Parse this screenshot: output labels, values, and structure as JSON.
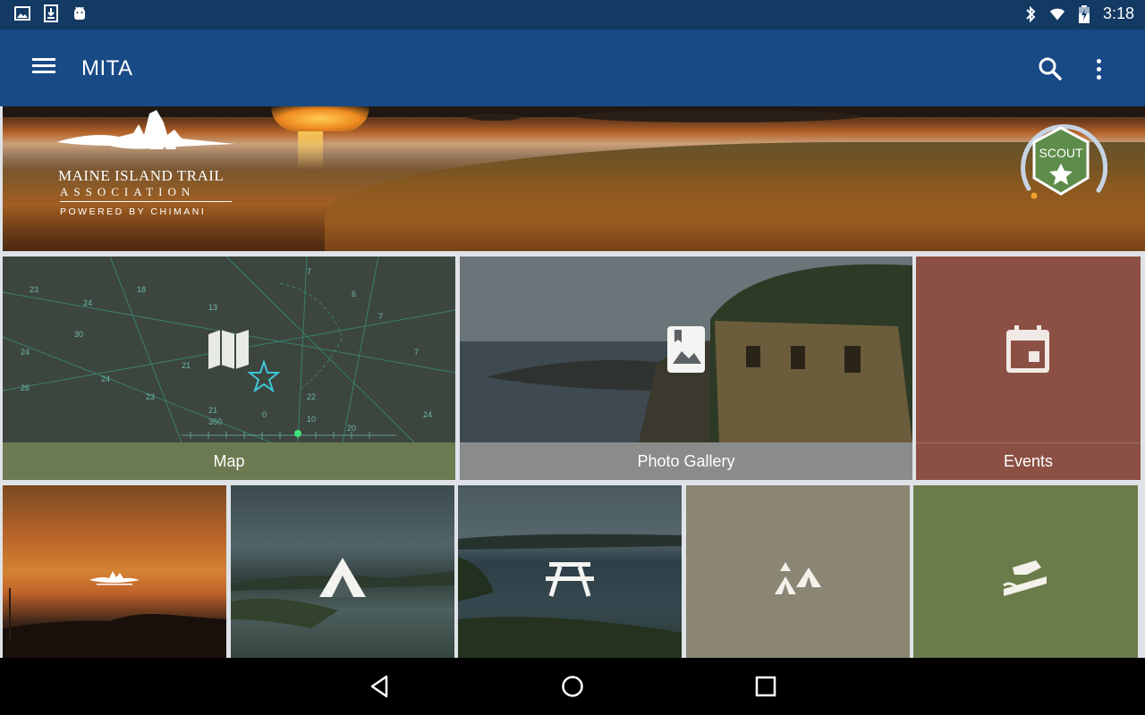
{
  "status_bar": {
    "time": "3:18",
    "left_icons": [
      "gallery-icon",
      "download-icon",
      "android-debug-icon"
    ],
    "right_icons": [
      "bluetooth-icon",
      "wifi-icon",
      "battery-icon"
    ]
  },
  "app_bar": {
    "title": "MITA",
    "menu_icon": "hamburger-menu-icon",
    "search_icon": "search-icon",
    "overflow_icon": "more-vert-icon",
    "background": "#184a86"
  },
  "hero": {
    "logo_name": "MAINE ISLAND TRAIL",
    "logo_sub": "ASSOCIATION",
    "logo_powered": "POWERED BY CHIMANI",
    "badge_label": "SCOUT",
    "badge_color": "#5e8c4a"
  },
  "tiles": {
    "map": {
      "label": "Map",
      "icon": "map-icon",
      "label_bg": "#6b7a50"
    },
    "photo_gallery": {
      "label": "Photo Gallery",
      "icon": "photo-gallery-icon",
      "label_bg": "#8a8b8b"
    },
    "events": {
      "label": "Events",
      "icon": "calendar-icon",
      "label_bg": "#8b5043"
    },
    "bottom_row_icons": [
      "mita-logo-icon",
      "tent-icon",
      "picnic-table-icon",
      "group-campsite-icon",
      "boat-launch-icon"
    ]
  },
  "nav_bar": {
    "icons": [
      "back-icon",
      "home-icon",
      "recents-icon"
    ]
  }
}
